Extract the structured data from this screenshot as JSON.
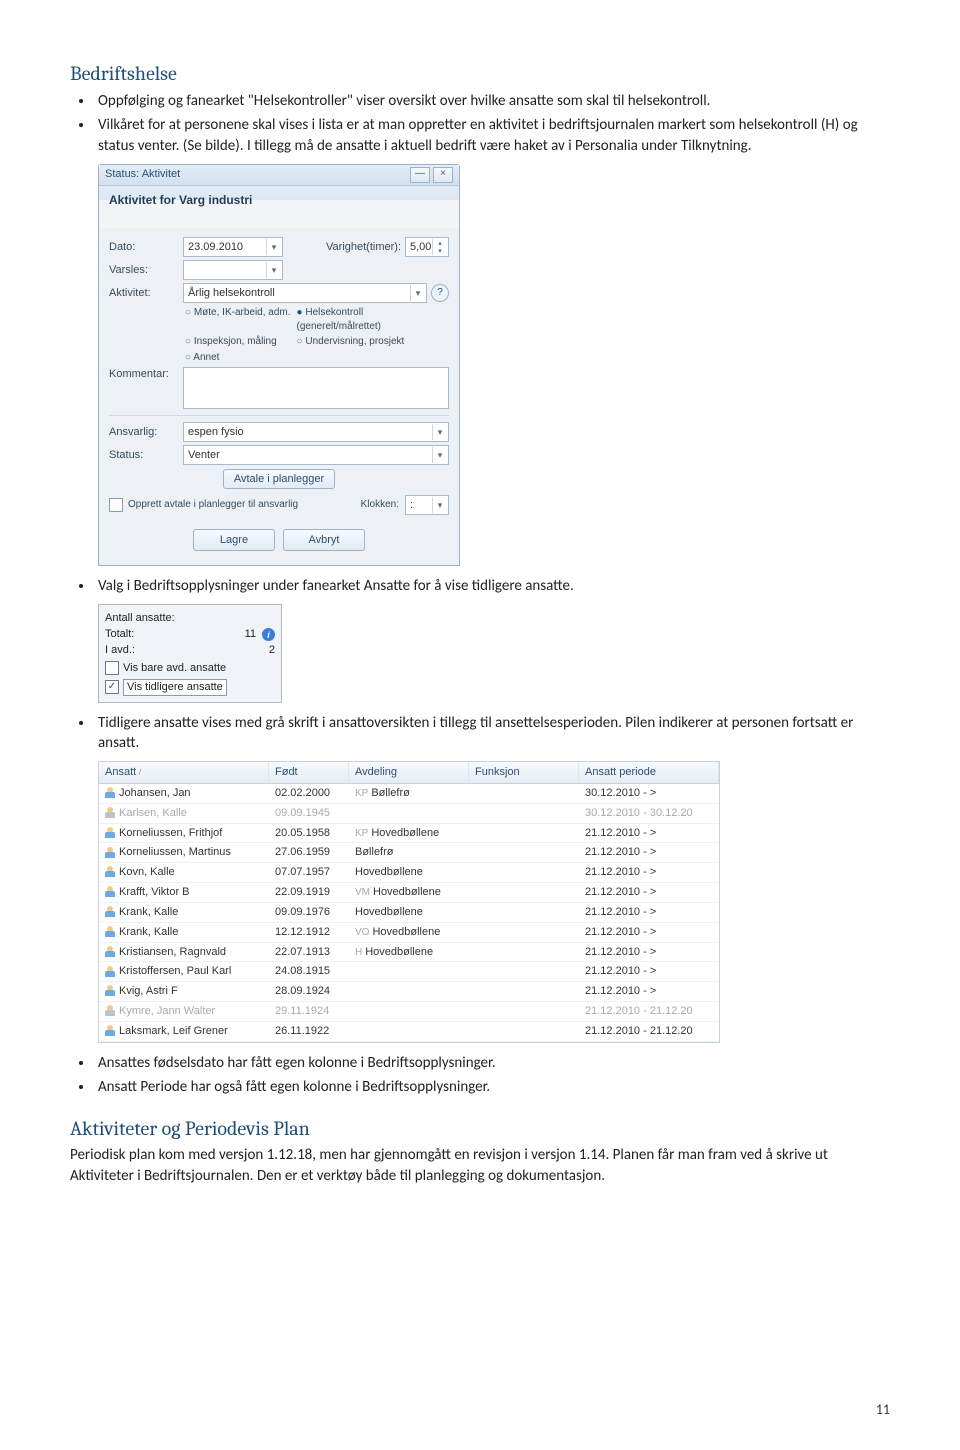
{
  "section1_title": "Bedriftshelse",
  "bullet1": "Oppfølging og fanearket \"Helsekontroller\" viser oversikt over hvilke ansatte som skal til helsekontroll.",
  "bullet2": "Vilkåret for at personene skal vises i lista er at man oppretter en aktivitet i bedriftsjournalen markert som helsekontroll (H) og status venter. (Se bilde). I tillegg må de ansatte i aktuell bedrift være haket av i Personalia under Tilknytning.",
  "dialog": {
    "titlebar_status": "Status: Aktivitet",
    "header": "Aktivitet for Varg industri",
    "labels": {
      "dato": "Dato:",
      "varighet": "Varighet(timer):",
      "varsles": "Varsles:",
      "aktivitet": "Aktivitet:",
      "kommentar": "Kommentar:",
      "ansvarlig": "Ansvarlig:",
      "status": "Status:",
      "klokken": "Klokken:"
    },
    "values": {
      "dato": "23.09.2010",
      "varighet": "5,00",
      "aktivitet": "Årlig helsekontroll",
      "ansvarlig": "espen fysio",
      "status": "Venter",
      "klokken": ":"
    },
    "radios": {
      "r1": "Møte, IK-arbeid, adm.",
      "r2": "Helsekontroll (generelt/målrettet)",
      "r3": "Inspeksjon, måling",
      "r4": "Undervisning, prosjekt",
      "r5": "Annet"
    },
    "avtale_btn": "Avtale i planlegger",
    "opprett_cb": "Opprett avtale i planlegger til ansvarlig",
    "lagre": "Lagre",
    "avbryt": "Avbryt"
  },
  "bullet3": "Valg i Bedriftsopplysninger under fanearket Ansatte for å vise tidligere ansatte.",
  "ansatte_box": {
    "line1": "Antall ansatte:",
    "totalt_label": "Totalt:",
    "totalt_val": "11",
    "iavd_label": "I avd.:",
    "iavd_val": "2",
    "cb1_label": "Vis bare avd. ansatte",
    "cb2_label": "Vis tidligere ansatte"
  },
  "bullet4": "Tidligere ansatte vises med grå skrift i ansattoversikten i tillegg til ansettelsesperioden. Pilen indikerer at personen fortsatt er ansatt.",
  "emp_header": {
    "c1": "Ansatt",
    "c2": "Født",
    "c3": "Avdeling",
    "c4": "Funksjon",
    "c5": "Ansatt periode"
  },
  "employees": [
    {
      "name": "Johansen, Jan",
      "dob": "02.02.2000",
      "deptPre": "KP",
      "dept": "Bøllefrø",
      "func": "",
      "period": "30.12.2010 - >",
      "inactive": false
    },
    {
      "name": "Karlsen, Kalle",
      "dob": "09.09.1945",
      "deptPre": "",
      "dept": "",
      "func": "",
      "period": "30.12.2010 - 30.12.20",
      "inactive": true
    },
    {
      "name": "Korneliussen, Frithjof",
      "dob": "20.05.1958",
      "deptPre": "KP",
      "dept": "Hovedbøllene",
      "func": "",
      "period": "21.12.2010 - >",
      "inactive": false
    },
    {
      "name": "Korneliussen, Martinus",
      "dob": "27.06.1959",
      "deptPre": "",
      "dept": "Bøllefrø",
      "func": "",
      "period": "21.12.2010 - >",
      "inactive": false
    },
    {
      "name": "Kovn, Kalle",
      "dob": "07.07.1957",
      "deptPre": "",
      "dept": "Hovedbøllene",
      "func": "",
      "period": "21.12.2010 - >",
      "inactive": false
    },
    {
      "name": "Krafft, Viktor B",
      "dob": "22.09.1919",
      "deptPre": "VM",
      "dept": "Hovedbøllene",
      "func": "",
      "period": "21.12.2010 - >",
      "inactive": false
    },
    {
      "name": "Krank, Kalle",
      "dob": "09.09.1976",
      "deptPre": "",
      "dept": "Hovedbøllene",
      "func": "",
      "period": "21.12.2010 - >",
      "inactive": false
    },
    {
      "name": "Krank, Kalle",
      "dob": "12.12.1912",
      "deptPre": "VO",
      "dept": "Hovedbøllene",
      "func": "",
      "period": "21.12.2010 - >",
      "inactive": false
    },
    {
      "name": "Kristiansen, Ragnvald",
      "dob": "22.07.1913",
      "deptPre": "H",
      "dept": "Hovedbøllene",
      "func": "",
      "period": "21.12.2010 - >",
      "inactive": false
    },
    {
      "name": "Kristoffersen, Paul Karl",
      "dob": "24.08.1915",
      "deptPre": "",
      "dept": "",
      "func": "",
      "period": "21.12.2010 - >",
      "inactive": false
    },
    {
      "name": "Kvig, Astri F",
      "dob": "28.09.1924",
      "deptPre": "",
      "dept": "",
      "func": "",
      "period": "21.12.2010 - >",
      "inactive": false
    },
    {
      "name": "Kymre, Jann Walter",
      "dob": "29.11.1924",
      "deptPre": "",
      "dept": "",
      "func": "",
      "period": "21.12.2010 - 21.12.20",
      "inactive": true
    },
    {
      "name": "Laksmark, Leif Grener",
      "dob": "26.11.1922",
      "deptPre": "",
      "dept": "",
      "func": "",
      "period": "21.12.2010 - 21.12.20",
      "inactive": false
    }
  ],
  "bullet5": "Ansattes fødselsdato har fått egen kolonne i Bedriftsopplysninger.",
  "bullet6": "Ansatt Periode har også fått egen kolonne i Bedriftsopplysninger.",
  "section2_title": "Aktiviteter og Periodevis Plan",
  "section2_body": "Periodisk plan kom med versjon 1.12.18, men har gjennomgått en revisjon i versjon 1.14. Planen får man fram ved å skrive ut Aktiviteter i Bedriftsjournalen. Den er et verktøy både til planlegging og dokumentasjon.",
  "page_num": "11"
}
